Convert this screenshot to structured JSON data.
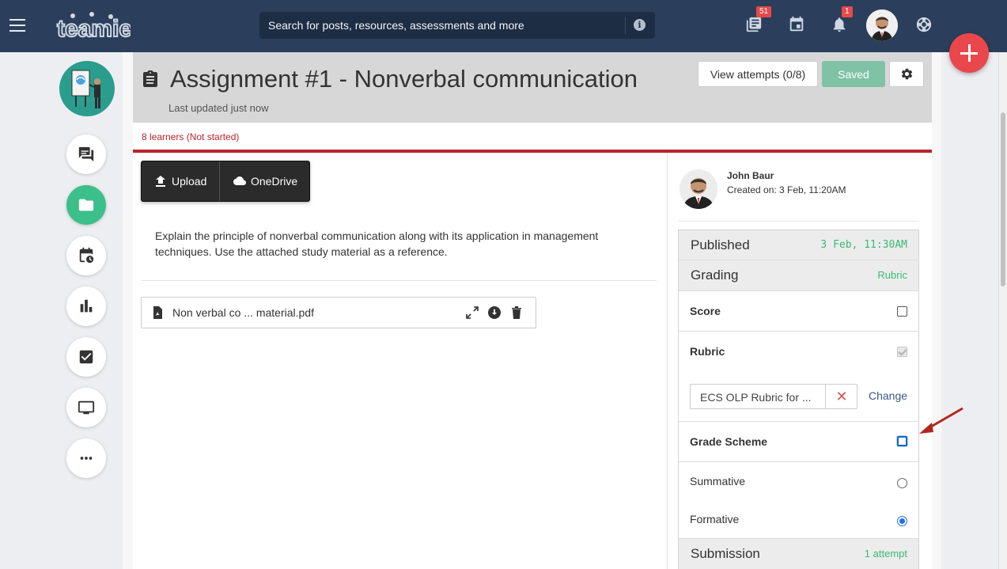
{
  "topbar": {
    "logo_text": "teamie",
    "search_placeholder": "Search for posts, resources, assessments and more",
    "info_icon": "info-icon",
    "news_badge": "51",
    "notifications_badge": "1",
    "icons": [
      "menu-icon",
      "newsfeed-icon",
      "calendar-icon",
      "bell-icon",
      "user-avatar",
      "help-icon",
      "add-icon"
    ]
  },
  "rail": {
    "items": [
      "discussion-icon",
      "folder-icon",
      "schedule-icon",
      "analytics-icon",
      "checkbox-icon",
      "screen-icon",
      "more-icon"
    ],
    "active": "folder-icon"
  },
  "header": {
    "title": "Assignment #1 - Nonverbal communication",
    "updated": "Last updated just now",
    "view_attempts": "View attempts (0/8)",
    "saved": "Saved"
  },
  "learners": "8 learners (Not started)",
  "toolbar": {
    "upload": "Upload",
    "onedrive": "OneDrive"
  },
  "description": "Explain the principle of nonverbal communication along with its application in management techniques. Use the attached study material as a reference.",
  "attachment": {
    "name": "Non verbal co ... material.pdf"
  },
  "author": {
    "name": "John Baur",
    "created": "Created on: 3 Feb, 11:20AM"
  },
  "settings": {
    "published_label": "Published",
    "published_value": "3 Feb, 11:30AM",
    "grading_label": "Grading",
    "grading_value": "Rubric",
    "score_label": "Score",
    "score_checked": false,
    "rubric_label": "Rubric",
    "rubric_checked": true,
    "rubric_name": "ECS OLP Rubric for ...",
    "change": "Change",
    "grade_scheme_label": "Grade Scheme",
    "grade_scheme_checked": false,
    "summative": "Summative",
    "formative": "Formative",
    "selected_scheme": "Formative",
    "submission_label": "Submission",
    "submission_value": "1 attempt"
  },
  "colors": {
    "topbar": "#2b3f5c",
    "accent_green": "#3cb878",
    "alert_red": "#b8252b",
    "fab": "#e9474c"
  }
}
